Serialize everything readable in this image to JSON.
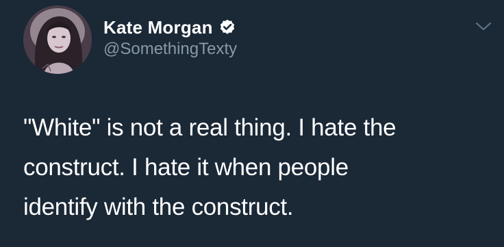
{
  "author": {
    "display_name": "Kate Morgan",
    "handle": "@SomethingTexty",
    "verified": true
  },
  "icons": {
    "verified": "verified-badge-icon",
    "menu": "chevron-down-icon"
  },
  "tweet": {
    "lines": [
      "\"White\" is not a real thing. I hate the",
      "construct. I hate it when people",
      "identify with the construct."
    ]
  },
  "colors": {
    "background": "#1b2836",
    "text": "#ffffff",
    "secondary_text": "#8899a6"
  }
}
